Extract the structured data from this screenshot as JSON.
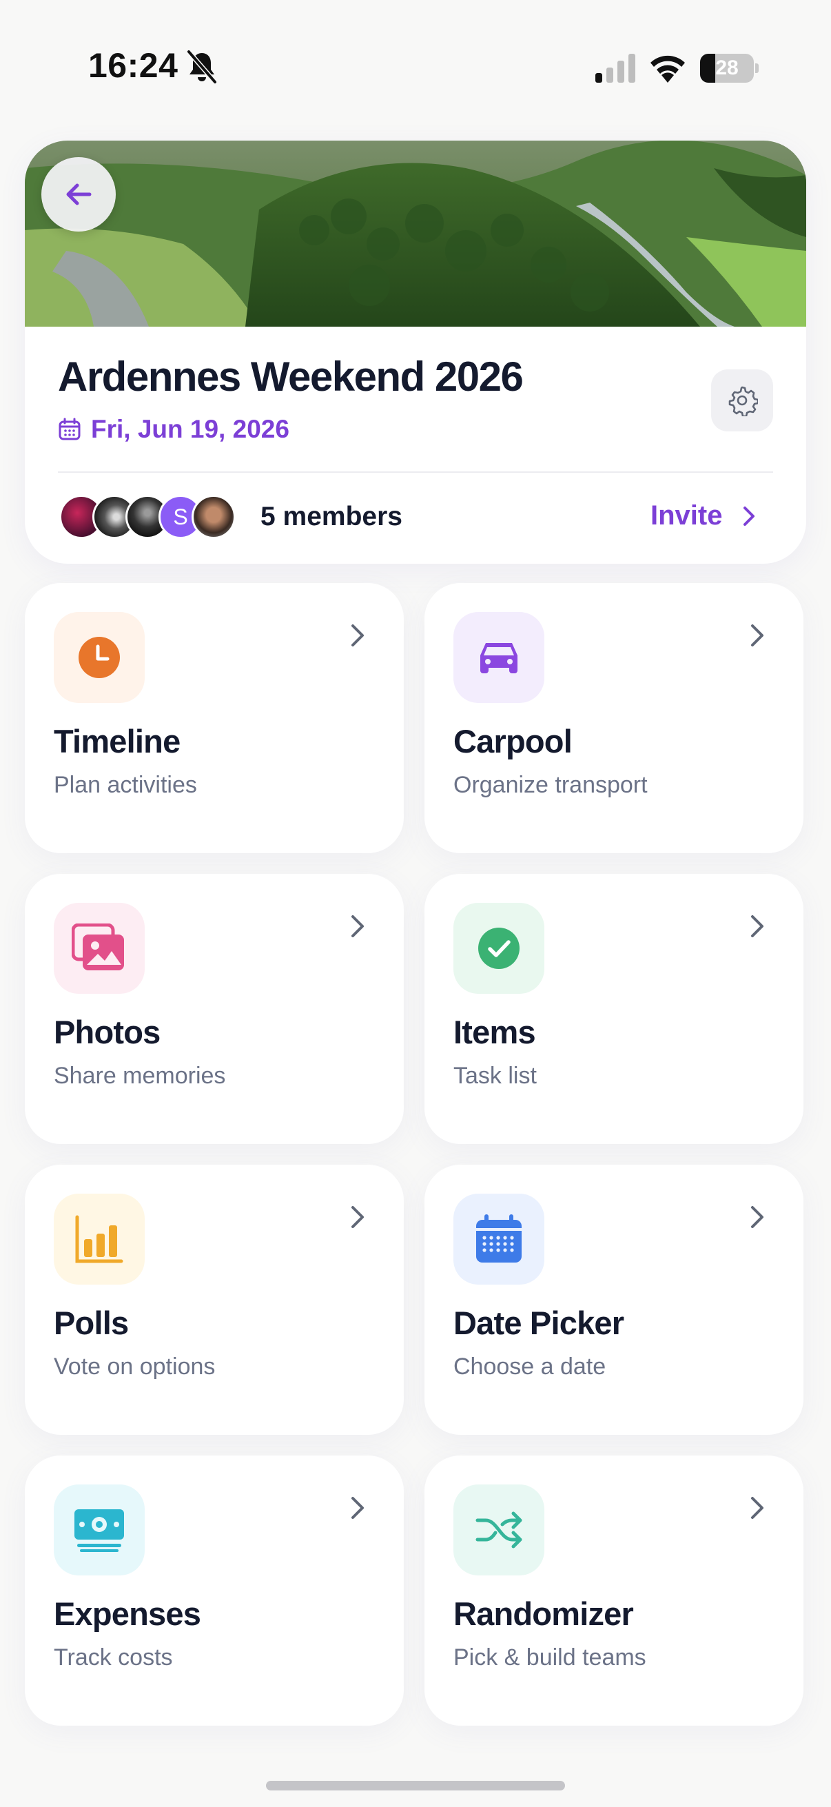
{
  "status_bar": {
    "time": "16:24",
    "battery_level": "28",
    "battery_fraction": 0.28,
    "icons": [
      "bell-slash-icon",
      "cellular-signal-icon",
      "wifi-icon",
      "battery-icon"
    ]
  },
  "header": {
    "back_icon": "arrow-left-icon",
    "settings_icon": "gear-icon",
    "title": "Ardennes Weekend 2026",
    "date": "Fri, Jun 19, 2026",
    "date_icon": "calendar-icon",
    "members_count_label": "5 members",
    "avatar_letter": "S",
    "invite_label": "Invite",
    "accent_color": "#7c3fd6"
  },
  "features": [
    {
      "title": "Timeline",
      "subtitle": "Plan activities",
      "icon": "clock-icon",
      "color": "#e8762b",
      "bg": "#fff3ea"
    },
    {
      "title": "Carpool",
      "subtitle": "Organize transport",
      "icon": "car-icon",
      "color": "#8b47e0",
      "bg": "#f3edfd"
    },
    {
      "title": "Photos",
      "subtitle": "Share memories",
      "icon": "photos-icon",
      "color": "#e2508a",
      "bg": "#fdedf3"
    },
    {
      "title": "Items",
      "subtitle": "Task list",
      "icon": "check-circle-icon",
      "color": "#3bb273",
      "bg": "#e9f8ef"
    },
    {
      "title": "Polls",
      "subtitle": "Vote on options",
      "icon": "bar-chart-icon",
      "color": "#f0a92a",
      "bg": "#fff7e4"
    },
    {
      "title": "Date Picker",
      "subtitle": "Choose a date",
      "icon": "calendar-grid-icon",
      "color": "#3e7be8",
      "bg": "#eaf1fe"
    },
    {
      "title": "Expenses",
      "subtitle": "Track costs",
      "icon": "cash-icon",
      "color": "#2bb6cf",
      "bg": "#e6f8fb"
    },
    {
      "title": "Randomizer",
      "subtitle": "Pick & build teams",
      "icon": "shuffle-icon",
      "color": "#35b59a",
      "bg": "#e8f8f3"
    }
  ]
}
